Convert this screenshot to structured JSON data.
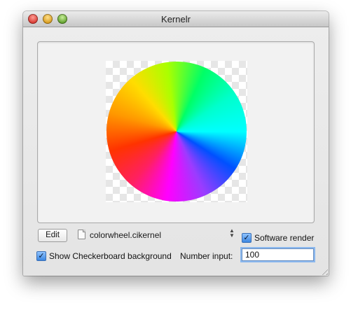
{
  "window": {
    "title": "Kernelr"
  },
  "toolbar": {
    "edit_label": "Edit",
    "kernel_file": "colorwheel.cikernel",
    "software_render": {
      "label": "Software render",
      "checked": true
    },
    "checkerboard": {
      "label": "Show Checkerboard background",
      "checked": true
    },
    "number_input": {
      "label": "Number input:",
      "value": "100"
    }
  },
  "icons": {
    "close": "close-button-icon",
    "minimize": "minimize-button-icon",
    "zoom": "zoom-button-icon",
    "file": "document-icon",
    "stepper": "up-down-arrows-icon",
    "resize": "resize-grip-icon"
  },
  "colors": {
    "window_bg": "#ececec",
    "focus_ring": "#8bb8ee",
    "checkbox_blue": "#3b86e0"
  }
}
